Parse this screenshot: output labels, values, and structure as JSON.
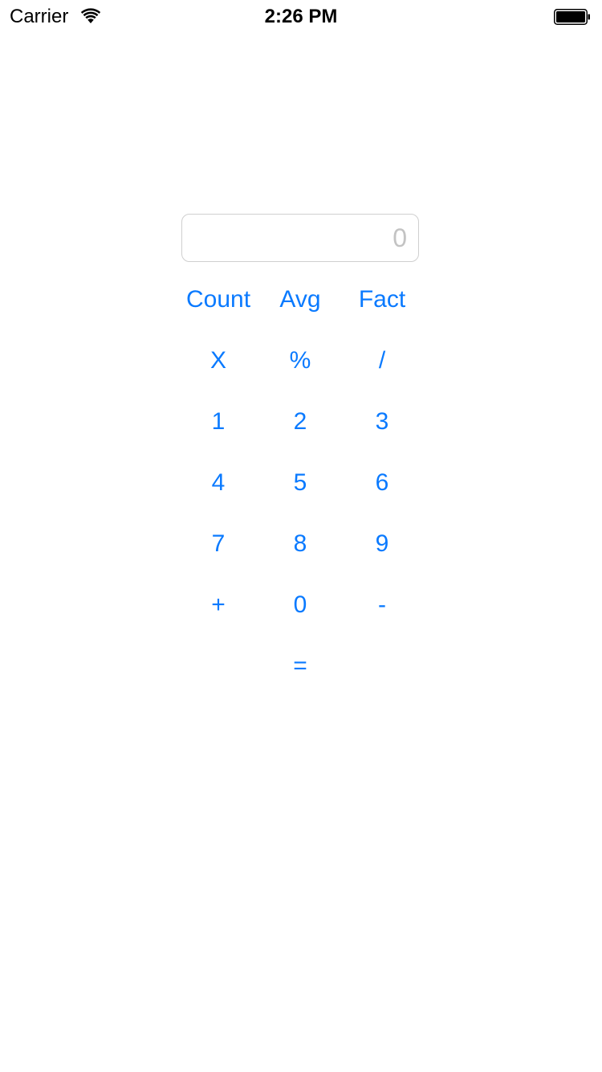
{
  "status_bar": {
    "carrier": "Carrier",
    "time": "2:26 PM",
    "wifi_icon": "wifi-icon",
    "battery_icon": "battery-icon"
  },
  "display": {
    "value": "",
    "placeholder": "0"
  },
  "keys": {
    "count": "Count",
    "avg": "Avg",
    "fact": "Fact",
    "multiply": "X",
    "percent": "%",
    "divide": "/",
    "one": "1",
    "two": "2",
    "three": "3",
    "four": "4",
    "five": "5",
    "six": "6",
    "seven": "7",
    "eight": "8",
    "nine": "9",
    "plus": "+",
    "zero": "0",
    "minus": "-",
    "equals": "="
  },
  "colors": {
    "accent": "#0a7aff",
    "placeholder": "#c3c3c3",
    "border": "#cfcfcf"
  }
}
